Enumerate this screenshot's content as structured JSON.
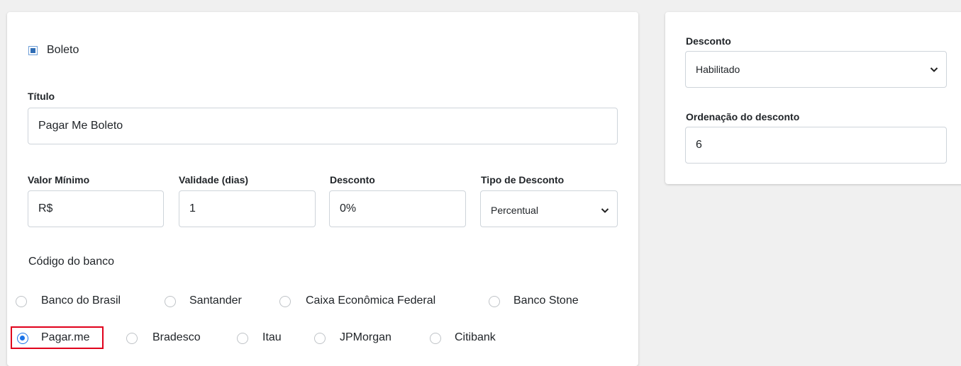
{
  "payment": {
    "boleto_label": "Boleto",
    "titulo_label": "Título",
    "titulo_value": "Pagar Me Boleto",
    "valor_minimo_label": "Valor Mínimo",
    "valor_minimo_value": "R$",
    "validade_label": "Validade (dias)",
    "validade_value": "1",
    "desconto_label": "Desconto",
    "desconto_value": "0%",
    "tipo_desconto_label": "Tipo de Desconto",
    "tipo_desconto_value": "Percentual",
    "codigo_banco_label": "Código do banco",
    "banks": [
      {
        "label": "Banco do Brasil",
        "checked": false
      },
      {
        "label": "Santander",
        "checked": false
      },
      {
        "label": "Caixa Econômica Federal",
        "checked": false
      },
      {
        "label": "Banco Stone",
        "checked": false
      },
      {
        "label": "Pagar.me",
        "checked": true
      },
      {
        "label": "Bradesco",
        "checked": false
      },
      {
        "label": "Itau",
        "checked": false
      },
      {
        "label": "JPMorgan",
        "checked": false
      },
      {
        "label": "Citibank",
        "checked": false
      }
    ]
  },
  "sidebar": {
    "desconto_label": "Desconto",
    "desconto_value": "Habilitado",
    "ordenacao_label": "Ordenação do desconto",
    "ordenacao_value": "6"
  },
  "icons": {
    "select_arrow": "chevron-down-icon",
    "checkbox": "checkbox-checked-icon"
  },
  "colors": {
    "accent": "#1a73e8",
    "checkbox_fill": "#2f6db5",
    "highlight": "#e0001b"
  }
}
